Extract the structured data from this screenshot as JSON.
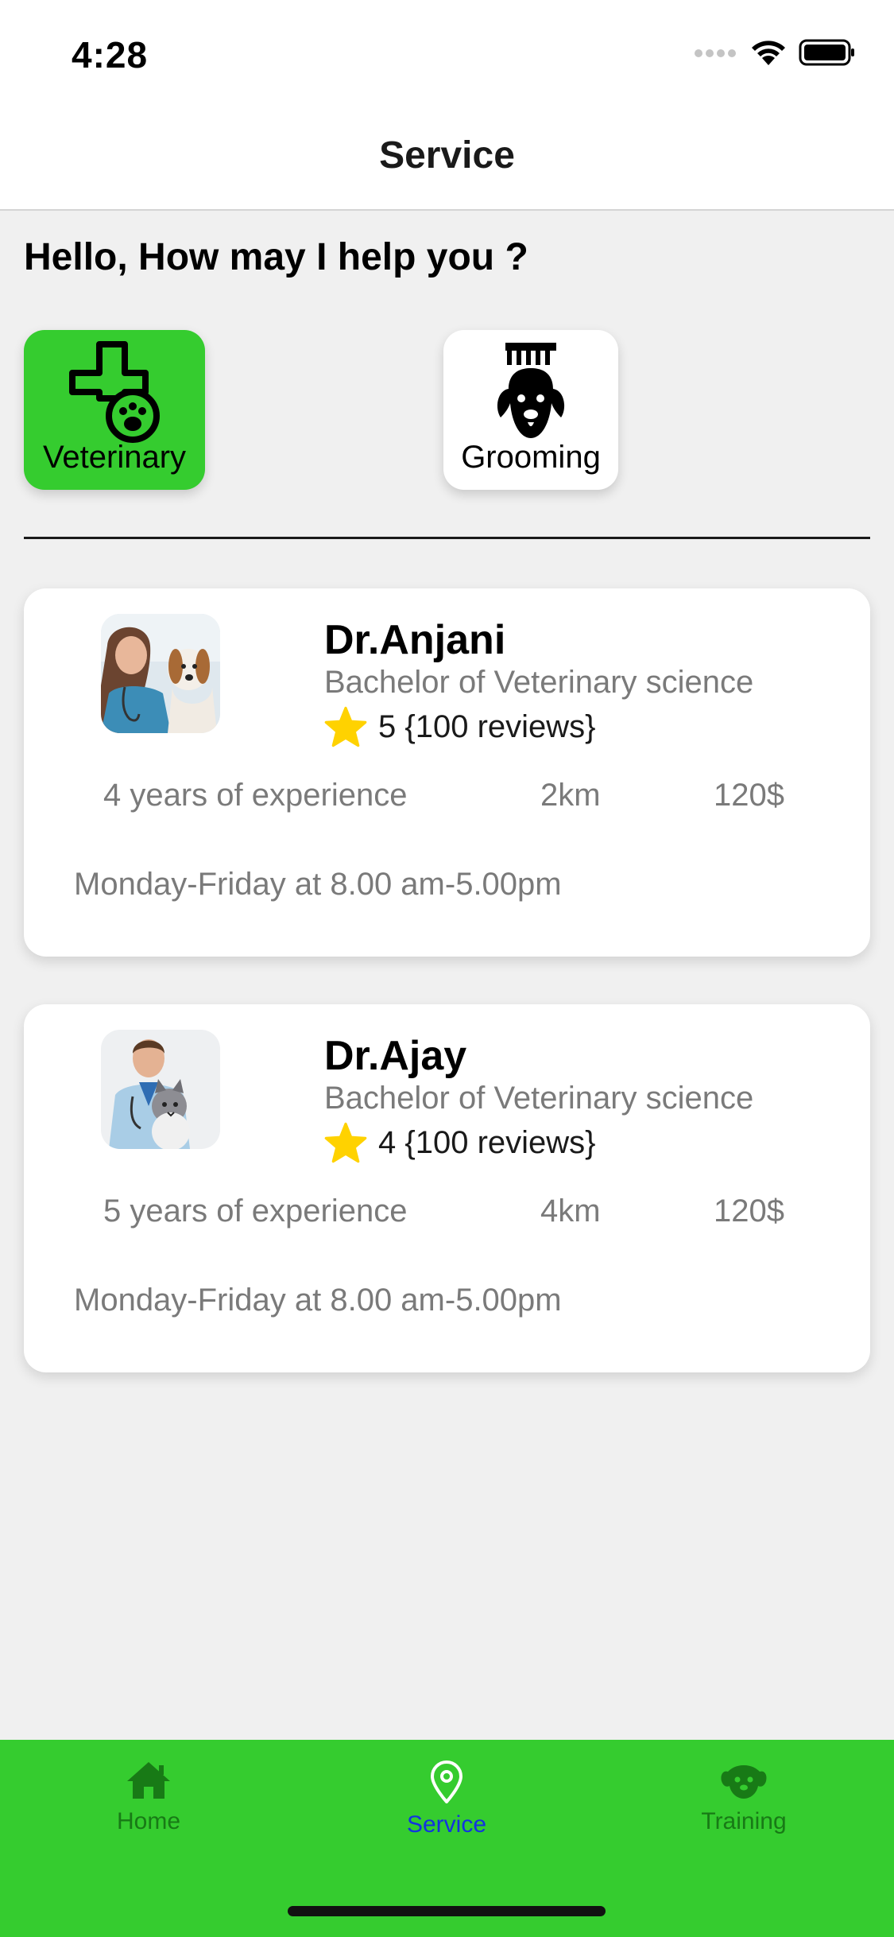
{
  "status_bar": {
    "time": "4:28"
  },
  "header": {
    "title": "Service"
  },
  "greeting": "Hello, How may I help you ?",
  "categories": [
    {
      "label": "Veterinary",
      "icon": "medical-cross-paw-icon",
      "selected": true,
      "color": "#35cc2f"
    },
    {
      "label": "Grooming",
      "icon": "dog-comb-icon",
      "selected": false,
      "color": "#ffffff"
    }
  ],
  "doctors": [
    {
      "name": "Dr.Anjani",
      "degree": "Bachelor of Veterinary science",
      "rating": "5 {100 reviews}",
      "experience": "4 years of experience",
      "distance": "2km",
      "price": "120$",
      "hours": "Monday-Friday at 8.00 am-5.00pm"
    },
    {
      "name": "Dr.Ajay",
      "degree": "Bachelor of Veterinary science",
      "rating": "4 {100 reviews}",
      "experience": "5 years of experience",
      "distance": "4km",
      "price": "120$",
      "hours": "Monday-Friday at 8.00 am-5.00pm"
    }
  ],
  "tabbar": {
    "items": [
      {
        "label": "Home",
        "icon": "home-icon",
        "active": false
      },
      {
        "label": "Service",
        "icon": "location-pin-icon",
        "active": true
      },
      {
        "label": "Training",
        "icon": "dog-face-icon",
        "active": false
      }
    ]
  },
  "colors": {
    "accent": "#35cc2f",
    "active_tab": "#1233e0",
    "star": "#ffd200"
  }
}
